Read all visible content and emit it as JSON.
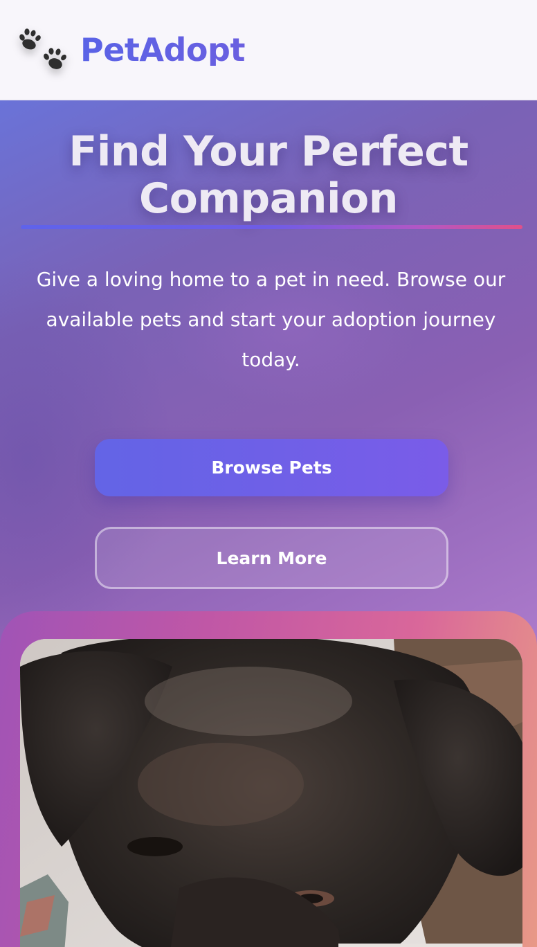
{
  "header": {
    "brand": "PetAdopt",
    "logo_icon": "paw-prints-icon"
  },
  "hero": {
    "title_line1": "Find Your Perfect",
    "title_line2": "Companion",
    "description": "Give a loving home to a pet in need. Browse our available pets and start your adoption journey today.",
    "primary_button": "Browse Pets",
    "secondary_button": "Learn More"
  },
  "featured_image": {
    "subject": "dog-photo"
  },
  "colors": {
    "brand": "#5a63e6",
    "primary_button": "#6f60e8",
    "underline_start": "#5f63ea",
    "underline_end": "#e0508a"
  }
}
